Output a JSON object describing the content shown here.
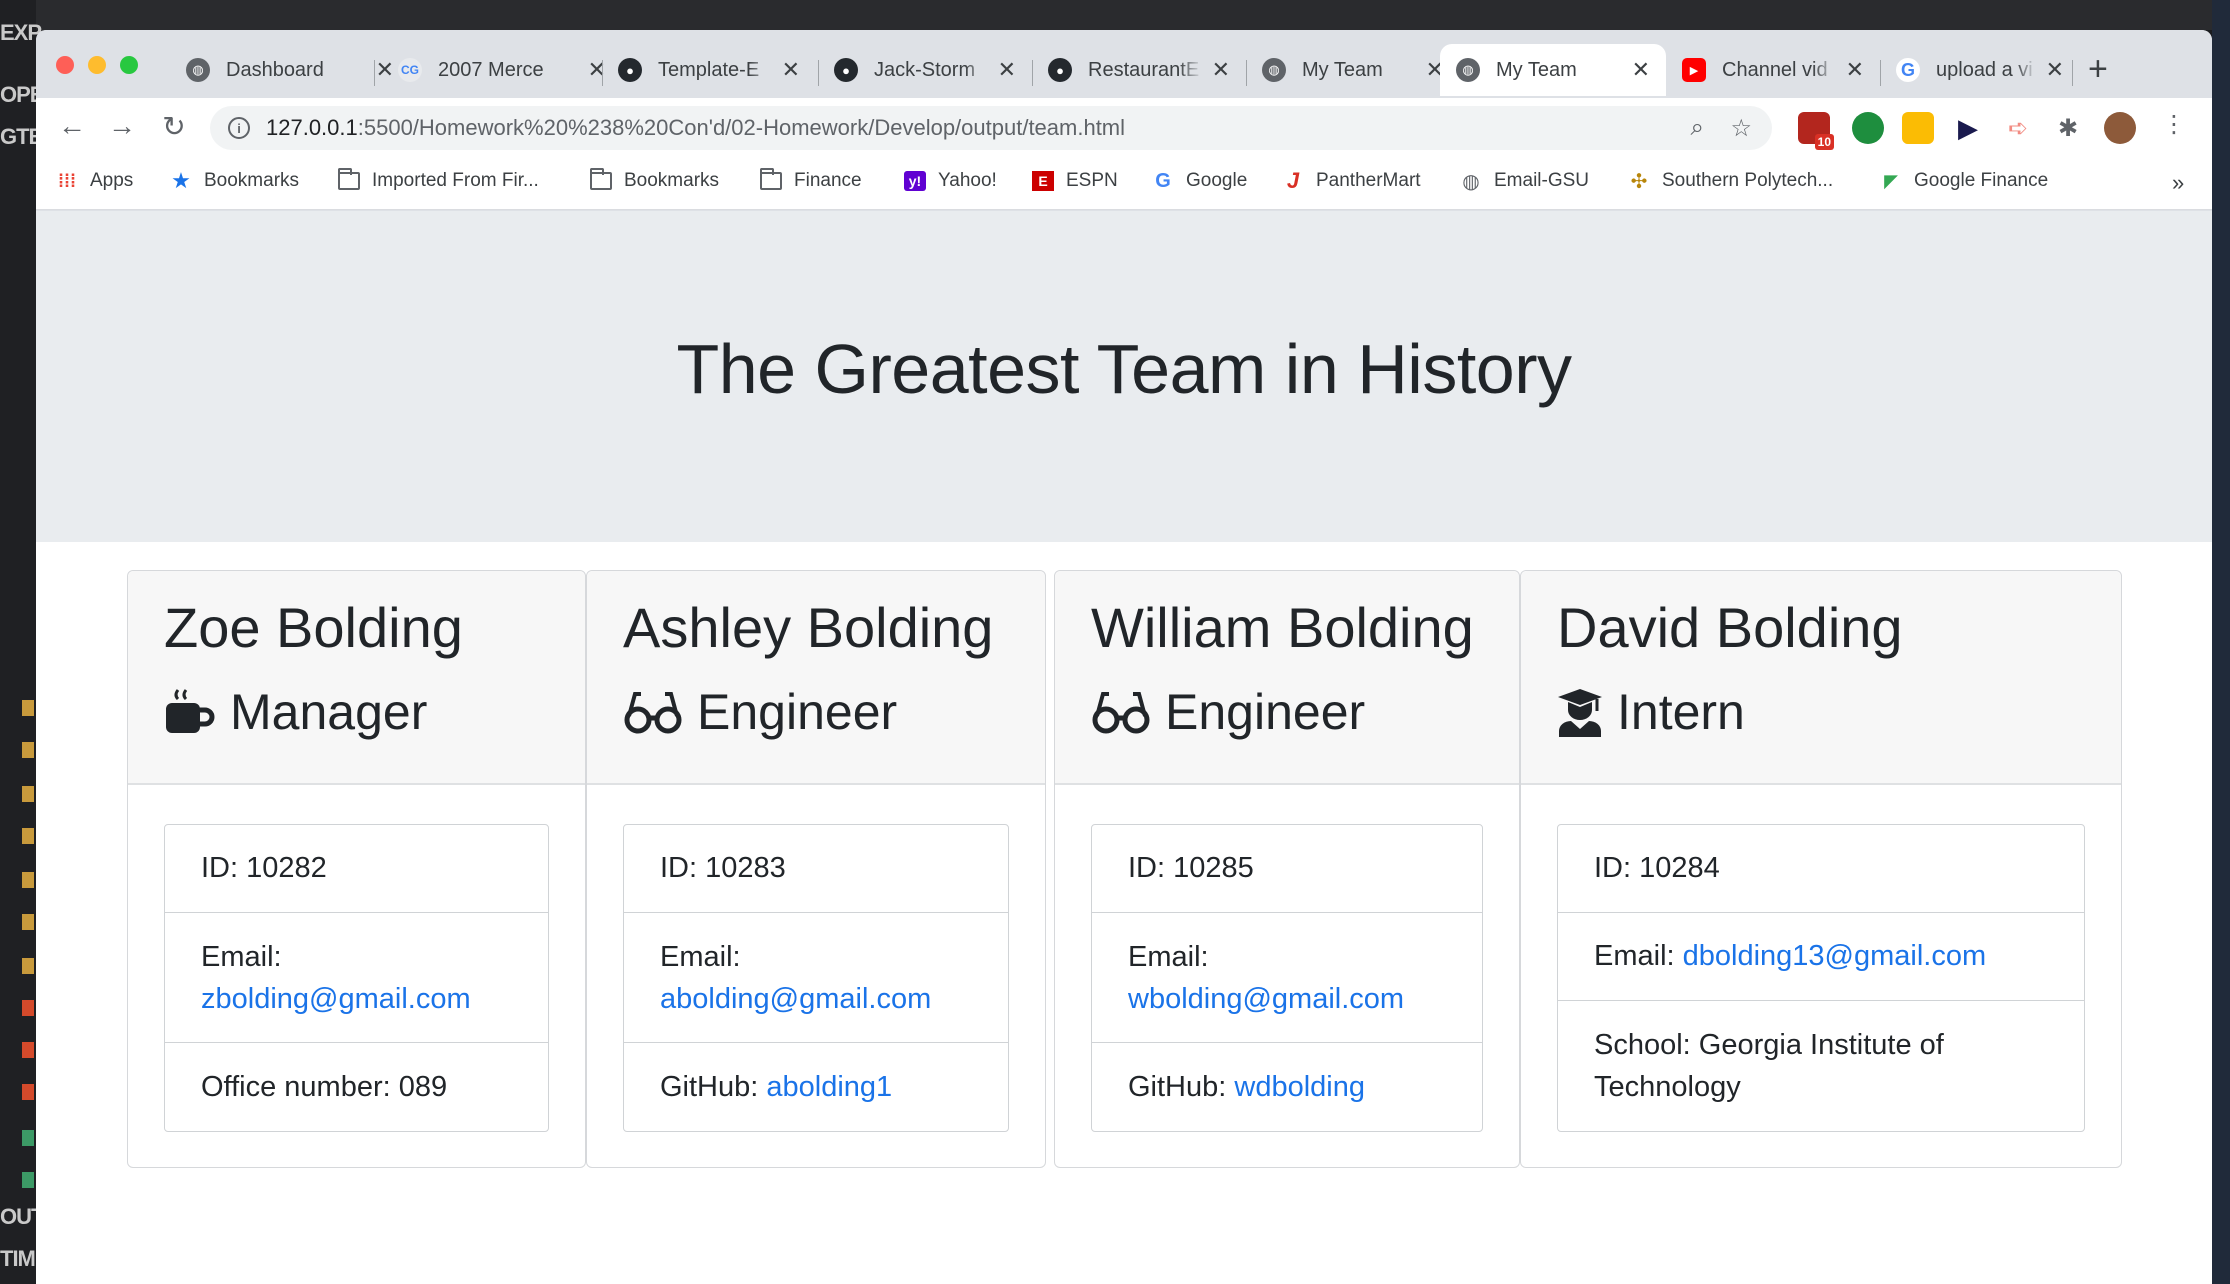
{
  "browser": {
    "tabs": [
      {
        "title": "Dashboard",
        "icon": "globe-icon",
        "active": false
      },
      {
        "title": "2007 Merce",
        "icon": "cg-icon",
        "active": false
      },
      {
        "title": "Template-E",
        "icon": "github-icon",
        "active": false
      },
      {
        "title": "Jack-Storm",
        "icon": "github-icon",
        "active": false
      },
      {
        "title": "RestaurantE",
        "icon": "github-icon",
        "active": false
      },
      {
        "title": "My Team",
        "icon": "globe-icon",
        "active": false
      },
      {
        "title": "My Team",
        "icon": "globe-icon",
        "active": true
      },
      {
        "title": "Channel vid",
        "icon": "youtube-icon",
        "active": false
      },
      {
        "title": "upload a vi",
        "icon": "google-icon",
        "active": false
      }
    ],
    "url_host": "127.0.0.1",
    "url_path": ":5500/Homework%20%238%20Con'd/02-Homework/Develop/output/team.html",
    "extension_badge": "10",
    "bookmarks": [
      {
        "label": "Apps",
        "icon": "apps-grid-icon"
      },
      {
        "label": "Bookmarks",
        "icon": "star-icon"
      },
      {
        "label": "Imported From Fir...",
        "icon": "folder-icon"
      },
      {
        "label": "Bookmarks",
        "icon": "folder-icon"
      },
      {
        "label": "Finance",
        "icon": "folder-icon"
      },
      {
        "label": "Yahoo!",
        "icon": "yahoo-icon"
      },
      {
        "label": "ESPN",
        "icon": "espn-icon"
      },
      {
        "label": "Google",
        "icon": "google-icon"
      },
      {
        "label": "PantherMart",
        "icon": "panthermart-icon"
      },
      {
        "label": "Email-GSU",
        "icon": "globe-icon"
      },
      {
        "label": "Southern Polytech...",
        "icon": "polytech-icon"
      },
      {
        "label": "Google Finance",
        "icon": "google-finance-icon"
      }
    ],
    "overflow": "»"
  },
  "page": {
    "title": "The Greatest Team in History",
    "members": [
      {
        "name": "Zoe Bolding",
        "role": "Manager",
        "role_icon": "coffee-mug-icon",
        "id_text": "ID: 10282",
        "email_label": "Email:",
        "email": "zbolding@gmail.com",
        "extra_label": "Office number: 089",
        "extra_link": ""
      },
      {
        "name": "Ashley Bolding",
        "role": "Engineer",
        "role_icon": "glasses-icon",
        "id_text": "ID: 10283",
        "email_label": "Email:",
        "email": "abolding@gmail.com",
        "extra_label": "GitHub: ",
        "extra_link": "abolding1"
      },
      {
        "name": "William Bolding",
        "role": "Engineer",
        "role_icon": "glasses-icon",
        "id_text": "ID: 10285",
        "email_label": "Email:",
        "email": "wbolding@gmail.com",
        "extra_label": "GitHub: ",
        "extra_link": "wdbolding"
      },
      {
        "name": "David Bolding",
        "role": "Intern",
        "role_icon": "graduate-icon",
        "id_text": "ID: 10284",
        "email_label": "Email: ",
        "email": "dbolding13@gmail.com",
        "extra_label": "School: Georgia Institute of Technology",
        "extra_link": ""
      }
    ]
  },
  "background_app": {
    "labels": [
      "EXP",
      "OPE",
      "GTB",
      "OUT",
      "TIM"
    ]
  },
  "colors": {
    "link": "#1a73e8",
    "jumbotron": "#e9ecef",
    "card_header": "#f7f7f7",
    "tab_strip": "#dee1e6"
  }
}
